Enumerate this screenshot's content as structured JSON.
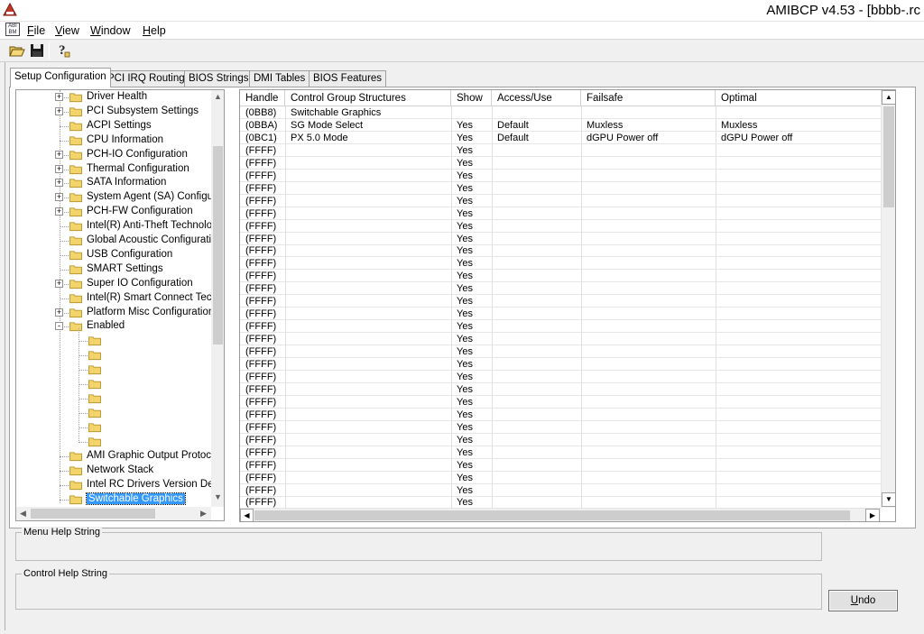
{
  "window": {
    "title": "AMIBCP v4.53 - [bbbb-.rc"
  },
  "menu": [
    {
      "label": "File",
      "key": "F",
      "rest": "ile"
    },
    {
      "label": "View",
      "key": "V",
      "rest": "iew"
    },
    {
      "label": "Window",
      "key": "W",
      "rest": "indow"
    },
    {
      "label": "Help",
      "key": "H",
      "rest": "elp"
    }
  ],
  "toolbar": {
    "icons": [
      "open-folder-icon",
      "save-icon",
      "help-icon"
    ]
  },
  "tabs": [
    "Setup Configuration",
    "PCI IRQ Routing",
    "BIOS Strings",
    "DMI Tables",
    "BIOS Features"
  ],
  "tree": {
    "items": [
      {
        "label": "Driver Health",
        "expander": "+"
      },
      {
        "label": "PCI Subsystem Settings",
        "expander": "+"
      },
      {
        "label": "ACPI Settings",
        "expander": ""
      },
      {
        "label": "CPU Information",
        "expander": ""
      },
      {
        "label": "PCH-IO Configuration",
        "expander": "+"
      },
      {
        "label": "Thermal Configuration",
        "expander": "+"
      },
      {
        "label": "SATA Information",
        "expander": "+"
      },
      {
        "label": "System Agent (SA) Configurat",
        "expander": "+"
      },
      {
        "label": "PCH-FW Configuration",
        "expander": "+"
      },
      {
        "label": "Intel(R) Anti-Theft Technolog",
        "expander": ""
      },
      {
        "label": "Global Acoustic Configuration",
        "expander": ""
      },
      {
        "label": "USB Configuration",
        "expander": ""
      },
      {
        "label": "SMART Settings",
        "expander": ""
      },
      {
        "label": "Super IO Configuration",
        "expander": "+"
      },
      {
        "label": "Intel(R) Smart Connect Techn",
        "expander": ""
      },
      {
        "label": "Platform Misc Configuration",
        "expander": "+"
      },
      {
        "label": "Enabled",
        "expander": "-"
      }
    ],
    "child_count": 8,
    "bottom_items": [
      {
        "label": "AMI Graphic Output Protocol"
      },
      {
        "label": "Network Stack"
      },
      {
        "label": "Intel RC Drivers Version Deta"
      },
      {
        "label": "Switchable Graphics",
        "selected": true
      }
    ]
  },
  "grid": {
    "columns": [
      "Handle",
      "Control Group Structures",
      "Show",
      "Access/Use",
      "Failsafe",
      "Optimal"
    ],
    "rows": [
      [
        "(0BB8)",
        "Switchable Graphics",
        "",
        "",
        "",
        ""
      ],
      [
        "(0BBA)",
        "SG Mode Select",
        "Yes",
        "Default",
        "Muxless",
        "Muxless"
      ],
      [
        "(0BC1)",
        "PX 5.0 Mode",
        "Yes",
        "Default",
        "dGPU Power off",
        "dGPU Power off"
      ],
      [
        "(FFFF)",
        "",
        "Yes",
        "",
        "",
        ""
      ],
      [
        "(FFFF)",
        "",
        "Yes",
        "",
        "",
        ""
      ],
      [
        "(FFFF)",
        "",
        "Yes",
        "",
        "",
        ""
      ],
      [
        "(FFFF)",
        "",
        "Yes",
        "",
        "",
        ""
      ],
      [
        "(FFFF)",
        "",
        "Yes",
        "",
        "",
        ""
      ],
      [
        "(FFFF)",
        "",
        "Yes",
        "",
        "",
        ""
      ],
      [
        "(FFFF)",
        "",
        "Yes",
        "",
        "",
        ""
      ],
      [
        "(FFFF)",
        "",
        "Yes",
        "",
        "",
        ""
      ],
      [
        "(FFFF)",
        "",
        "Yes",
        "",
        "",
        ""
      ],
      [
        "(FFFF)",
        "",
        "Yes",
        "",
        "",
        ""
      ],
      [
        "(FFFF)",
        "",
        "Yes",
        "",
        "",
        ""
      ],
      [
        "(FFFF)",
        "",
        "Yes",
        "",
        "",
        ""
      ],
      [
        "(FFFF)",
        "",
        "Yes",
        "",
        "",
        ""
      ],
      [
        "(FFFF)",
        "",
        "Yes",
        "",
        "",
        ""
      ],
      [
        "(FFFF)",
        "",
        "Yes",
        "",
        "",
        ""
      ],
      [
        "(FFFF)",
        "",
        "Yes",
        "",
        "",
        ""
      ],
      [
        "(FFFF)",
        "",
        "Yes",
        "",
        "",
        ""
      ],
      [
        "(FFFF)",
        "",
        "Yes",
        "",
        "",
        ""
      ],
      [
        "(FFFF)",
        "",
        "Yes",
        "",
        "",
        ""
      ],
      [
        "(FFFF)",
        "",
        "Yes",
        "",
        "",
        ""
      ],
      [
        "(FFFF)",
        "",
        "Yes",
        "",
        "",
        ""
      ],
      [
        "(FFFF)",
        "",
        "Yes",
        "",
        "",
        ""
      ],
      [
        "(FFFF)",
        "",
        "Yes",
        "",
        "",
        ""
      ],
      [
        "(FFFF)",
        "",
        "Yes",
        "",
        "",
        ""
      ],
      [
        "(FFFF)",
        "",
        "Yes",
        "",
        "",
        ""
      ],
      [
        "(FFFF)",
        "",
        "Yes",
        "",
        "",
        ""
      ],
      [
        "(FFFF)",
        "",
        "Yes",
        "",
        "",
        ""
      ],
      [
        "(FFFF)",
        "",
        "Yes",
        "",
        "",
        ""
      ],
      [
        "(FFFF)",
        "",
        "Yes",
        "",
        "",
        ""
      ],
      [
        "(FFFF)",
        "",
        "Yes",
        "",
        "",
        ""
      ]
    ]
  },
  "help": {
    "menu_help_label": "Menu Help String",
    "control_help_label": "Control Help String"
  },
  "buttons": {
    "undo_key": "U",
    "undo_rest": "ndo"
  },
  "colors": {
    "selection": "#3399ff",
    "folder": "#f3d46a"
  }
}
